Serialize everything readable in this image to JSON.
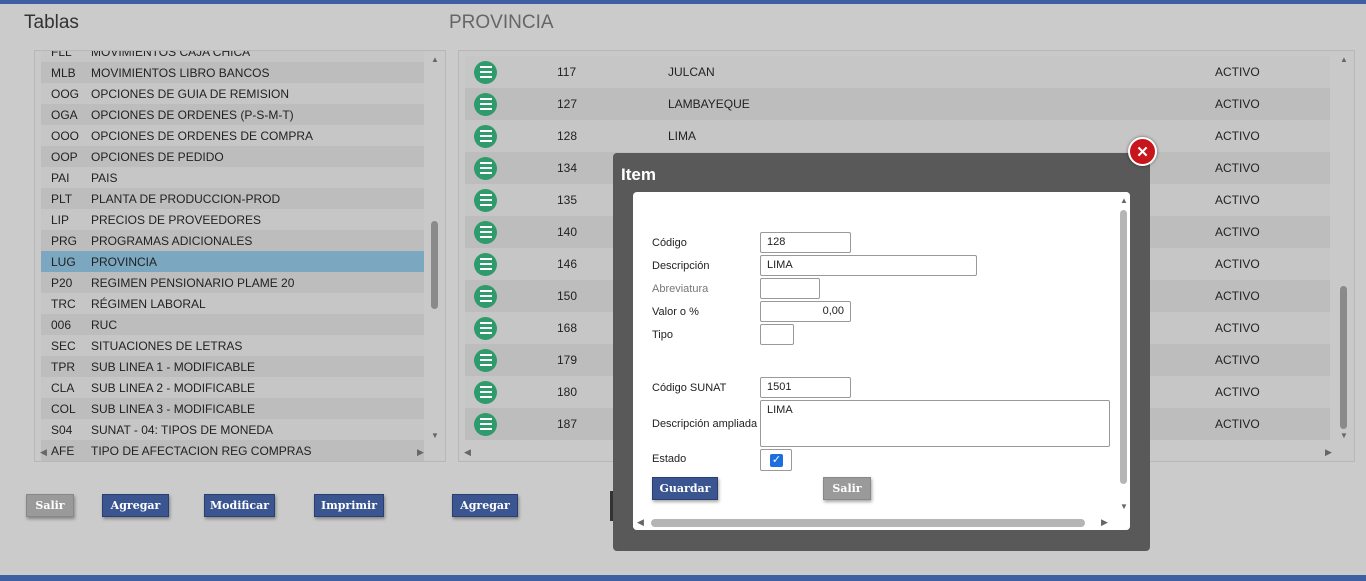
{
  "left_title": "Tablas",
  "right_title": "PROVINCIA",
  "left_rows": [
    {
      "code": "FLL",
      "desc": "MOVIMIENTOS CAJA CHICA"
    },
    {
      "code": "MLB",
      "desc": "MOVIMIENTOS LIBRO BANCOS"
    },
    {
      "code": "OOG",
      "desc": "OPCIONES DE GUIA DE REMISION"
    },
    {
      "code": "OGA",
      "desc": "OPCIONES DE ORDENES (P-S-M-T)"
    },
    {
      "code": "OOO",
      "desc": "OPCIONES DE ORDENES DE COMPRA"
    },
    {
      "code": "OOP",
      "desc": "OPCIONES DE PEDIDO"
    },
    {
      "code": "PAI",
      "desc": "PAIS"
    },
    {
      "code": "PLT",
      "desc": "PLANTA DE PRODUCCION-PROD"
    },
    {
      "code": "LIP",
      "desc": "PRECIOS DE PROVEEDORES"
    },
    {
      "code": "PRG",
      "desc": "PROGRAMAS ADICIONALES"
    },
    {
      "code": "LUG",
      "desc": "PROVINCIA"
    },
    {
      "code": "P20",
      "desc": "REGIMEN PENSIONARIO PLAME 20"
    },
    {
      "code": "TRC",
      "desc": "RÉGIMEN LABORAL"
    },
    {
      "code": "006",
      "desc": "RUC"
    },
    {
      "code": "SEC",
      "desc": "SITUACIONES DE LETRAS"
    },
    {
      "code": "TPR",
      "desc": "SUB LINEA 1 - MODIFICABLE"
    },
    {
      "code": "CLA",
      "desc": "SUB LINEA 2 - MODIFICABLE"
    },
    {
      "code": "COL",
      "desc": "SUB LINEA 3 - MODIFICABLE"
    },
    {
      "code": "S04",
      "desc": "SUNAT - 04: TIPOS DE MONEDA"
    },
    {
      "code": "AFE",
      "desc": "TIPO DE AFECTACION REG COMPRAS"
    }
  ],
  "right_rows": [
    {
      "code": "117",
      "name": "JULCAN",
      "status": "ACTIVO"
    },
    {
      "code": "127",
      "name": "LAMBAYEQUE",
      "status": "ACTIVO"
    },
    {
      "code": "128",
      "name": "LIMA",
      "status": "ACTIVO"
    },
    {
      "code": "134",
      "name": "",
      "status": "ACTIVO"
    },
    {
      "code": "135",
      "name": "",
      "status": "ACTIVO"
    },
    {
      "code": "140",
      "name": "",
      "status": "ACTIVO"
    },
    {
      "code": "146",
      "name": "",
      "status": "ACTIVO"
    },
    {
      "code": "150",
      "name": "",
      "status": "ACTIVO"
    },
    {
      "code": "168",
      "name": "",
      "status": "ACTIVO"
    },
    {
      "code": "179",
      "name": "",
      "status": "ACTIVO"
    },
    {
      "code": "180",
      "name": "",
      "status": "ACTIVO"
    },
    {
      "code": "187",
      "name": "",
      "status": "ACTIVO"
    }
  ],
  "left_buttons": {
    "salir": "Salir",
    "agregar": "Agregar",
    "modificar": "Modificar",
    "imprimir": "Imprimir"
  },
  "right_buttons": {
    "agregar": "Agregar"
  },
  "modal": {
    "title": "Item",
    "close_icon": "close-x-icon",
    "labels": {
      "codigo": "Código",
      "descripcion": "Descripción",
      "abreviatura": "Abreviatura",
      "valor": "Valor o %",
      "tipo": "Tipo",
      "codigo_sunat": "Código SUNAT",
      "descripcion_ampliada": "Descripción ampliada",
      "estado": "Estado"
    },
    "values": {
      "codigo": "128",
      "descripcion": "LIMA",
      "abreviatura": "",
      "valor": "0,00",
      "tipo": "",
      "codigo_sunat": "1501",
      "descripcion_ampliada": "LIMA",
      "estado_checked": true
    },
    "buttons": {
      "guardar": "Guardar",
      "salir": "Salir"
    }
  },
  "colors": {
    "accent_bar": "#3f5fa3",
    "selected_row": "#7ba7c1",
    "menu_icon": "#2f9a6c",
    "close_button": "#c8141b"
  }
}
